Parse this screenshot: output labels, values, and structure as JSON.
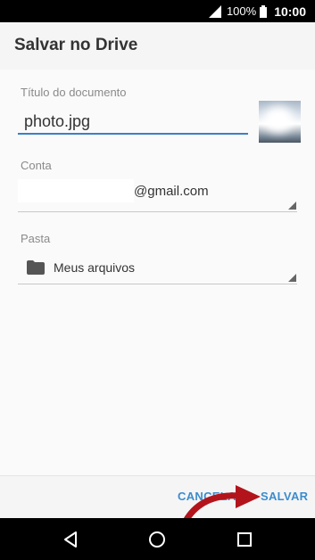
{
  "status_bar": {
    "battery_percent": "100%",
    "time": "10:00"
  },
  "dialog": {
    "title": "Salvar no Drive",
    "document_title_label": "Título do documento",
    "document_title_value": "photo.jpg",
    "account_label": "Conta",
    "account_value_suffix": "@gmail.com",
    "folder_label": "Pasta",
    "folder_value": "Meus arquivos"
  },
  "actions": {
    "cancel_label": "CANCELAR",
    "save_label": "SALVAR"
  },
  "colors": {
    "accent": "#3b8ccd",
    "annotation_arrow": "#b3141c"
  }
}
